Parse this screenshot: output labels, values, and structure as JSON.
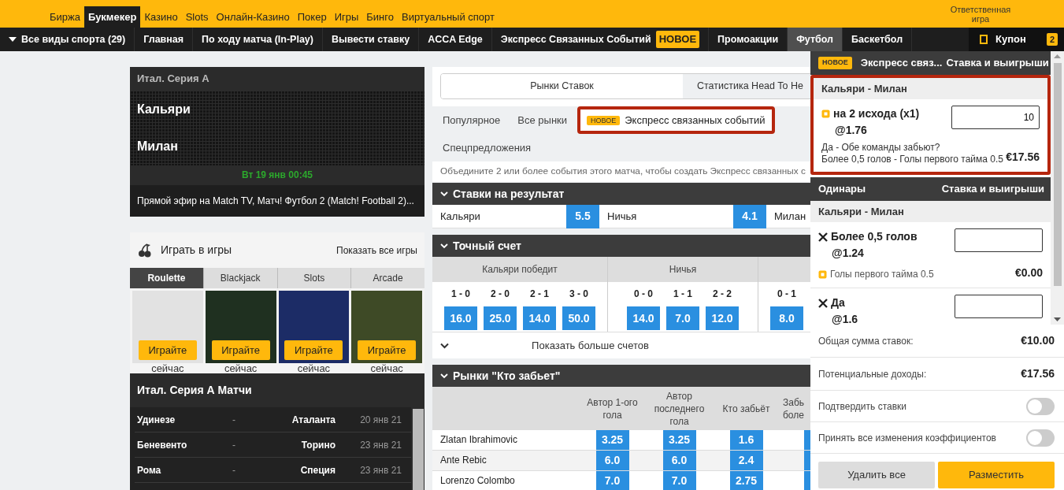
{
  "top_nav": {
    "items": [
      {
        "label": "Биржа",
        "selected": false
      },
      {
        "label": "Букмекер",
        "selected": true
      },
      {
        "label": "Казино",
        "selected": false
      },
      {
        "label": "Slots",
        "selected": false
      },
      {
        "label": "Онлайн-Казино",
        "selected": false
      },
      {
        "label": "Покер",
        "selected": false
      },
      {
        "label": "Игры",
        "selected": false
      },
      {
        "label": "Бинго",
        "selected": false
      },
      {
        "label": "Виртуальный спорт",
        "selected": false
      }
    ],
    "responsible_gaming": "Ответственная игра"
  },
  "sport_nav": {
    "items": [
      {
        "label": "Все виды спорта (29)",
        "kind": "dropdown",
        "selected": false
      },
      {
        "label": "Главная",
        "kind": "link",
        "selected": false
      },
      {
        "label": "По ходу матча (In-Play)",
        "kind": "link",
        "selected": false
      },
      {
        "label": "Вывести ставку",
        "kind": "link",
        "selected": false
      },
      {
        "label": "ACCA Edge",
        "kind": "link",
        "selected": false
      },
      {
        "label": "Экспресс Связанных Событий",
        "kind": "link",
        "badge": "НОВОЕ",
        "selected": false
      },
      {
        "label": "Промоакции",
        "kind": "link",
        "selected": false
      },
      {
        "label": "Футбол",
        "kind": "link",
        "selected": true
      },
      {
        "label": "Баскетбол",
        "kind": "link",
        "selected": false
      }
    ],
    "coupon": {
      "label": "Купон",
      "count": "2"
    }
  },
  "match": {
    "league": "Итал. Серия А",
    "home": "Кальяри",
    "away": "Милан",
    "datetime": "Вт 19 янв 00:45",
    "broadcast": "Прямой эфир на Match TV, Матч! Футбол 2 (Match! Football 2)..."
  },
  "games": {
    "title": "Играть в игры",
    "show_all": "Показать все игры",
    "tabs": [
      {
        "label": "Roulette",
        "selected": true
      },
      {
        "label": "Blackjack",
        "selected": false
      },
      {
        "label": "Slots",
        "selected": false
      },
      {
        "label": "Arcade",
        "selected": false
      }
    ],
    "tiles": [
      {
        "button": "Играйте",
        "caption": "сейчас"
      },
      {
        "button": "Играйте",
        "caption": "сейчас"
      },
      {
        "button": "Играйте",
        "caption": "сейчас"
      },
      {
        "button": "Играйте",
        "caption": "сейчас"
      }
    ]
  },
  "league_matches": {
    "title": "Итал. Серия А Матчи",
    "rows": [
      {
        "home": "Удинезе",
        "separator": "-",
        "away": "Аталанта",
        "date": "20 янв 21"
      },
      {
        "home": "Беневенто",
        "separator": "-",
        "away": "Торино",
        "date": "23 янв 21"
      },
      {
        "home": "Рома",
        "separator": "-",
        "away": "Специя",
        "date": "23 янв 21"
      }
    ]
  },
  "market_tabs": [
    {
      "label": "Рынки Ставок",
      "selected": true
    },
    {
      "label": "Статистика Head To He",
      "selected": false
    }
  ],
  "market_filters": [
    {
      "label": "Популярное",
      "selected": false,
      "highlighted": false
    },
    {
      "label": "Все рынки",
      "selected": false,
      "highlighted": false
    },
    {
      "label": "Экспресс связанных событий",
      "badge": "НОВОЕ",
      "selected": true,
      "highlighted": true
    },
    {
      "label": "Спецпредложения",
      "selected": false,
      "highlighted": false
    }
  ],
  "hint": "Объедините 2 или более события этого матча, чтобы создать Экспресс связанных с",
  "result_market": {
    "title": "Ставки на результат",
    "expanded": true,
    "outcomes": [
      {
        "label": "Кальяри",
        "odds": "5.5"
      },
      {
        "label": "Ничья",
        "odds": "4.1"
      },
      {
        "label": "Милан"
      }
    ]
  },
  "correct_score": {
    "title": "Точный счет",
    "expanded": true,
    "groups": [
      {
        "title": "Кальяри победит",
        "scores": [
          {
            "score": "1 - 0",
            "odds": "16.0"
          },
          {
            "score": "2 - 0",
            "odds": "25.0"
          },
          {
            "score": "2 - 1",
            "odds": "14.0"
          },
          {
            "score": "3 - 0",
            "odds": "50.0"
          }
        ]
      },
      {
        "title": "Ничья",
        "scores": [
          {
            "score": "0 - 0",
            "odds": "14.0"
          },
          {
            "score": "1 - 1",
            "odds": "7.0"
          },
          {
            "score": "2 - 2",
            "odds": "12.0"
          }
        ]
      },
      {
        "scores": [
          {
            "score": "0 - 1",
            "odds": "8.0"
          }
        ]
      }
    ],
    "show_more": "Показать больше счетов"
  },
  "scorer_market": {
    "title": "Рынки \"Кто забьет\"",
    "expanded": true,
    "columns": [
      "Автор 1-ого гола",
      "Автор последнего гола",
      "Кто забьёт",
      "Забь боле"
    ],
    "rows": [
      {
        "player": "Zlatan Ibrahimovic",
        "odds": [
          "3.25",
          "3.25",
          "1.6"
        ]
      },
      {
        "player": "Ante Rebic",
        "odds": [
          "6.0",
          "6.0",
          "2.4"
        ]
      },
      {
        "player": "Lorenzo Colombo",
        "odds": [
          "7.0",
          "7.0",
          "2.75"
        ]
      }
    ]
  },
  "betslip": {
    "bet_builder": {
      "badge": "НОВОЕ",
      "title": "Экспресс связ...",
      "stake_header": "Ставка и выигрыши",
      "highlighted": true,
      "event": "Кальяри - Милан",
      "selection": "на 2 исхода (x1)",
      "odds": "@1.76",
      "stake": "10",
      "legs": [
        "Да - Обе команды забьют?",
        "Более 0,5 голов - Голы первого тайма 0.5"
      ],
      "returns": "€17.56"
    },
    "singles": {
      "title": "Одинары",
      "stake_header": "Ставка и выигрыши",
      "event": "Кальяри - Милан",
      "bets": [
        {
          "selection": "Более 0,5 голов",
          "odds": "@1.24",
          "market": "Голы первого тайма 0.5",
          "returns": "€0.00"
        },
        {
          "selection": "Да",
          "odds": "@1.6"
        }
      ]
    },
    "summary": [
      {
        "label": "Общая сумма ставок:",
        "value": "€10.00"
      },
      {
        "label": "Потенциальные доходы:",
        "value": "€17.56"
      }
    ],
    "options": [
      {
        "label": "Подтвердить ставки",
        "on": false
      },
      {
        "label": "Принять все изменения коэффициентов",
        "on": false
      }
    ],
    "buttons": [
      {
        "label": "Удалить все",
        "kind": "secondary"
      },
      {
        "label": "Разместить",
        "kind": "primary"
      }
    ]
  }
}
